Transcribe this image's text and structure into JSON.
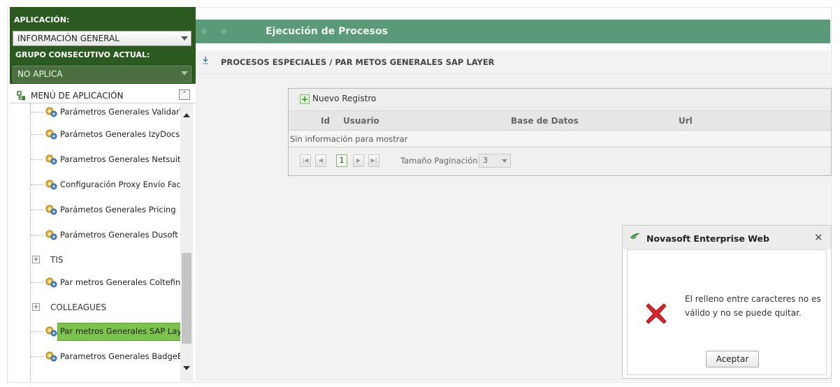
{
  "sidebar": {
    "app_label": "APLICACIÓN:",
    "app_value": "INFORMACIÓN GENERAL",
    "group_label": "GRUPO CONSECUTIVO ACTUAL:",
    "group_value": "NO APLICA",
    "menu_title": "MENÚ DE APLICACIÓN",
    "collapse_symbol": "⌃",
    "tree": [
      {
        "label": "Parámetros Generales ValidarT",
        "type": "item"
      },
      {
        "label": "Parámetos Generales IzyDocs",
        "type": "item"
      },
      {
        "label": "Parametros Generales Netsuite",
        "type": "item"
      },
      {
        "label": "Configuración Proxy Envío Fac",
        "type": "item"
      },
      {
        "label": "Parámetos Generales Pricing",
        "type": "item"
      },
      {
        "label": "Parámetros Generales Dusoft",
        "type": "item"
      },
      {
        "label": "TIS",
        "type": "group"
      },
      {
        "label": "Par metros Generales Coltefina",
        "type": "item"
      },
      {
        "label": "COLLEAGUES",
        "type": "group"
      },
      {
        "label": "Par metros Generales SAP Laye",
        "type": "item",
        "selected": true
      },
      {
        "label": "Parametros Generales BadgeB",
        "type": "item"
      }
    ]
  },
  "header": {
    "title": "Ejecución de Procesos",
    "breadcrumb": "PROCESOS ESPECIALES / PAR METOS GENERALES SAP LAYER"
  },
  "grid": {
    "new_button": "Nuevo Registro",
    "columns": [
      "Id",
      "Usuario",
      "Base de Datos",
      "Url"
    ],
    "empty_message": "Sin información para mostrar",
    "pager": {
      "first": "|◀",
      "prev": "◀",
      "current_page": "1",
      "next": "▶",
      "last": "▶|",
      "page_size_label": "Tamaño Paginación:",
      "page_size": "3"
    }
  },
  "dialog": {
    "title": "Novasoft Enterprise Web",
    "close": "✕",
    "message": "El relleno entre caracteres no es válido y no se puede quitar.",
    "accept_button": "Aceptar"
  },
  "colors": {
    "sidebar_dark": "#2a5a1f",
    "header_bar": "#5a9a78",
    "selected_item": "#7cc34d",
    "error": "#d9262c"
  }
}
